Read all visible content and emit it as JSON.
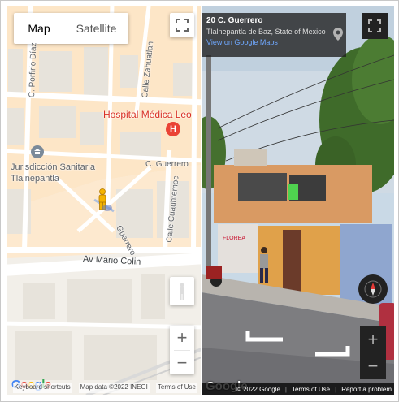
{
  "map": {
    "map_type_active": "Map",
    "map_type_inactive": "Satellite",
    "labels": {
      "porfirio": "C. Porfirio Díaz",
      "zahuatlan": "Calle Zahuatlan",
      "hospital": "Hospital Médica Leo",
      "jurisdiccion_1": "Jurisdicción Sanitaria",
      "jurisdiccion_2": "Tlalnepantla",
      "guerrero_h": "C. Guerrero",
      "guerrero_v": "Guerrero",
      "cuauhtemoc": "Calle Cuauhtémoc",
      "mario_colin": "Av Mario Colin"
    },
    "zoom_in": "+",
    "zoom_out": "−",
    "attribution": {
      "shortcuts": "Keyboard shortcuts",
      "data": "Map data ©2022 INEGI",
      "terms": "Terms of Use"
    },
    "logo": "Google"
  },
  "street_view": {
    "title": "20 C. Guerrero",
    "subtitle": "Tlalnepantla de Baz, State of Mexico",
    "link": "View on Google Maps",
    "sign_text": "FLOREA",
    "zoom_in": "+",
    "zoom_out": "−",
    "attribution": {
      "copyright": "© 2022 Google",
      "terms": "Terms of Use",
      "report": "Report a problem"
    },
    "logo": "Google"
  },
  "colors": {
    "road": "#ffffff",
    "block": "#f2efe9",
    "building": "#e8e4dc",
    "orange_area": "#fde6c7",
    "hospital_red": "#d93025",
    "sv_panel": "#222222",
    "link_blue": "#6fa8ff"
  }
}
